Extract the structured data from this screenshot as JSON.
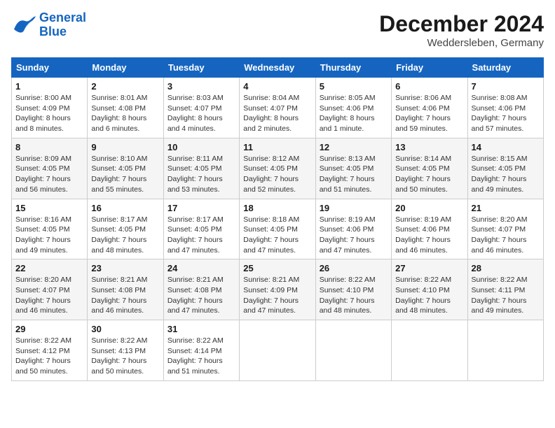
{
  "header": {
    "logo_line1": "General",
    "logo_line2": "Blue",
    "month_title": "December 2024",
    "location": "Weddersleben, Germany"
  },
  "weekdays": [
    "Sunday",
    "Monday",
    "Tuesday",
    "Wednesday",
    "Thursday",
    "Friday",
    "Saturday"
  ],
  "weeks": [
    [
      {
        "day": "1",
        "sunrise": "Sunrise: 8:00 AM",
        "sunset": "Sunset: 4:09 PM",
        "daylight": "Daylight: 8 hours and 8 minutes."
      },
      {
        "day": "2",
        "sunrise": "Sunrise: 8:01 AM",
        "sunset": "Sunset: 4:08 PM",
        "daylight": "Daylight: 8 hours and 6 minutes."
      },
      {
        "day": "3",
        "sunrise": "Sunrise: 8:03 AM",
        "sunset": "Sunset: 4:07 PM",
        "daylight": "Daylight: 8 hours and 4 minutes."
      },
      {
        "day": "4",
        "sunrise": "Sunrise: 8:04 AM",
        "sunset": "Sunset: 4:07 PM",
        "daylight": "Daylight: 8 hours and 2 minutes."
      },
      {
        "day": "5",
        "sunrise": "Sunrise: 8:05 AM",
        "sunset": "Sunset: 4:06 PM",
        "daylight": "Daylight: 8 hours and 1 minute."
      },
      {
        "day": "6",
        "sunrise": "Sunrise: 8:06 AM",
        "sunset": "Sunset: 4:06 PM",
        "daylight": "Daylight: 7 hours and 59 minutes."
      },
      {
        "day": "7",
        "sunrise": "Sunrise: 8:08 AM",
        "sunset": "Sunset: 4:06 PM",
        "daylight": "Daylight: 7 hours and 57 minutes."
      }
    ],
    [
      {
        "day": "8",
        "sunrise": "Sunrise: 8:09 AM",
        "sunset": "Sunset: 4:05 PM",
        "daylight": "Daylight: 7 hours and 56 minutes."
      },
      {
        "day": "9",
        "sunrise": "Sunrise: 8:10 AM",
        "sunset": "Sunset: 4:05 PM",
        "daylight": "Daylight: 7 hours and 55 minutes."
      },
      {
        "day": "10",
        "sunrise": "Sunrise: 8:11 AM",
        "sunset": "Sunset: 4:05 PM",
        "daylight": "Daylight: 7 hours and 53 minutes."
      },
      {
        "day": "11",
        "sunrise": "Sunrise: 8:12 AM",
        "sunset": "Sunset: 4:05 PM",
        "daylight": "Daylight: 7 hours and 52 minutes."
      },
      {
        "day": "12",
        "sunrise": "Sunrise: 8:13 AM",
        "sunset": "Sunset: 4:05 PM",
        "daylight": "Daylight: 7 hours and 51 minutes."
      },
      {
        "day": "13",
        "sunrise": "Sunrise: 8:14 AM",
        "sunset": "Sunset: 4:05 PM",
        "daylight": "Daylight: 7 hours and 50 minutes."
      },
      {
        "day": "14",
        "sunrise": "Sunrise: 8:15 AM",
        "sunset": "Sunset: 4:05 PM",
        "daylight": "Daylight: 7 hours and 49 minutes."
      }
    ],
    [
      {
        "day": "15",
        "sunrise": "Sunrise: 8:16 AM",
        "sunset": "Sunset: 4:05 PM",
        "daylight": "Daylight: 7 hours and 49 minutes."
      },
      {
        "day": "16",
        "sunrise": "Sunrise: 8:17 AM",
        "sunset": "Sunset: 4:05 PM",
        "daylight": "Daylight: 7 hours and 48 minutes."
      },
      {
        "day": "17",
        "sunrise": "Sunrise: 8:17 AM",
        "sunset": "Sunset: 4:05 PM",
        "daylight": "Daylight: 7 hours and 47 minutes."
      },
      {
        "day": "18",
        "sunrise": "Sunrise: 8:18 AM",
        "sunset": "Sunset: 4:05 PM",
        "daylight": "Daylight: 7 hours and 47 minutes."
      },
      {
        "day": "19",
        "sunrise": "Sunrise: 8:19 AM",
        "sunset": "Sunset: 4:06 PM",
        "daylight": "Daylight: 7 hours and 47 minutes."
      },
      {
        "day": "20",
        "sunrise": "Sunrise: 8:19 AM",
        "sunset": "Sunset: 4:06 PM",
        "daylight": "Daylight: 7 hours and 46 minutes."
      },
      {
        "day": "21",
        "sunrise": "Sunrise: 8:20 AM",
        "sunset": "Sunset: 4:07 PM",
        "daylight": "Daylight: 7 hours and 46 minutes."
      }
    ],
    [
      {
        "day": "22",
        "sunrise": "Sunrise: 8:20 AM",
        "sunset": "Sunset: 4:07 PM",
        "daylight": "Daylight: 7 hours and 46 minutes."
      },
      {
        "day": "23",
        "sunrise": "Sunrise: 8:21 AM",
        "sunset": "Sunset: 4:08 PM",
        "daylight": "Daylight: 7 hours and 46 minutes."
      },
      {
        "day": "24",
        "sunrise": "Sunrise: 8:21 AM",
        "sunset": "Sunset: 4:08 PM",
        "daylight": "Daylight: 7 hours and 47 minutes."
      },
      {
        "day": "25",
        "sunrise": "Sunrise: 8:21 AM",
        "sunset": "Sunset: 4:09 PM",
        "daylight": "Daylight: 7 hours and 47 minutes."
      },
      {
        "day": "26",
        "sunrise": "Sunrise: 8:22 AM",
        "sunset": "Sunset: 4:10 PM",
        "daylight": "Daylight: 7 hours and 48 minutes."
      },
      {
        "day": "27",
        "sunrise": "Sunrise: 8:22 AM",
        "sunset": "Sunset: 4:10 PM",
        "daylight": "Daylight: 7 hours and 48 minutes."
      },
      {
        "day": "28",
        "sunrise": "Sunrise: 8:22 AM",
        "sunset": "Sunset: 4:11 PM",
        "daylight": "Daylight: 7 hours and 49 minutes."
      }
    ],
    [
      {
        "day": "29",
        "sunrise": "Sunrise: 8:22 AM",
        "sunset": "Sunset: 4:12 PM",
        "daylight": "Daylight: 7 hours and 50 minutes."
      },
      {
        "day": "30",
        "sunrise": "Sunrise: 8:22 AM",
        "sunset": "Sunset: 4:13 PM",
        "daylight": "Daylight: 7 hours and 50 minutes."
      },
      {
        "day": "31",
        "sunrise": "Sunrise: 8:22 AM",
        "sunset": "Sunset: 4:14 PM",
        "daylight": "Daylight: 7 hours and 51 minutes."
      },
      null,
      null,
      null,
      null
    ]
  ]
}
